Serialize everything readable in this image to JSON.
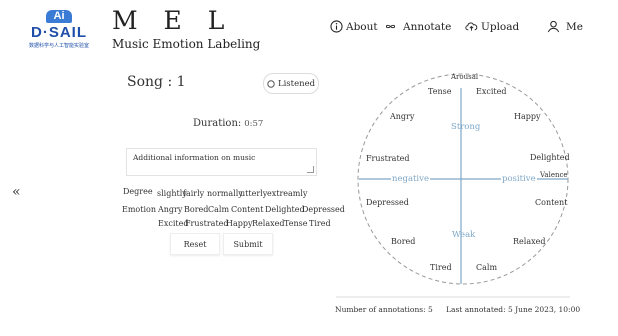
{
  "header": {
    "logo": {
      "badge": "Ai",
      "name": "D·SAIL",
      "tagline": "数据科学与人工智能实验室"
    },
    "title": "M E L",
    "subtitle": "Music Emotion Labeling",
    "nav": [
      {
        "label": "About",
        "icon": "info-circle-icon"
      },
      {
        "label": "Annotate",
        "icon": "infinity-icon"
      },
      {
        "label": "Upload",
        "icon": "cloud-upload-icon"
      },
      {
        "label": "Me",
        "icon": "user-icon"
      }
    ]
  },
  "song": {
    "label": "Song : 1",
    "listened_label": "Listened"
  },
  "duration": {
    "label": "Duration:",
    "value": "0:57"
  },
  "info": {
    "placeholder": "Additional information on music"
  },
  "degree": {
    "label": "Degree",
    "options": [
      "slightly",
      "fairly",
      "normally",
      "utterly",
      "extreamly"
    ]
  },
  "emotion": {
    "label": "Emotion",
    "options_row1": [
      "Angry",
      "Bored",
      "Calm",
      "Content",
      "Delighted",
      "Depressed"
    ],
    "options_row2": [
      "Excited",
      "Frustrated",
      "Happy",
      "Relaxed",
      "Tense",
      "Tired"
    ]
  },
  "buttons": {
    "reset": "Reset",
    "submit": "Submit"
  },
  "circumplex": {
    "axis_top": "Arousal",
    "axis_right": "Valence",
    "strong": "Strong",
    "weak": "Weak",
    "negative": "negative",
    "positive": "positive",
    "emotions": {
      "tense": "Tense",
      "excited": "Excited",
      "angry": "Angry",
      "happy": "Happy",
      "frustrated": "Frustrated",
      "delighted": "Delighted",
      "depressed": "Depressed",
      "content": "Content",
      "bored": "Bored",
      "relaxed": "Relaxed",
      "tired": "Tired",
      "calm": "Calm"
    },
    "axis_color": "#7fa7c8"
  },
  "footer": {
    "count": "Number of annotations: 5",
    "last": "Last annotated: 5 June 2023, 10:00"
  }
}
